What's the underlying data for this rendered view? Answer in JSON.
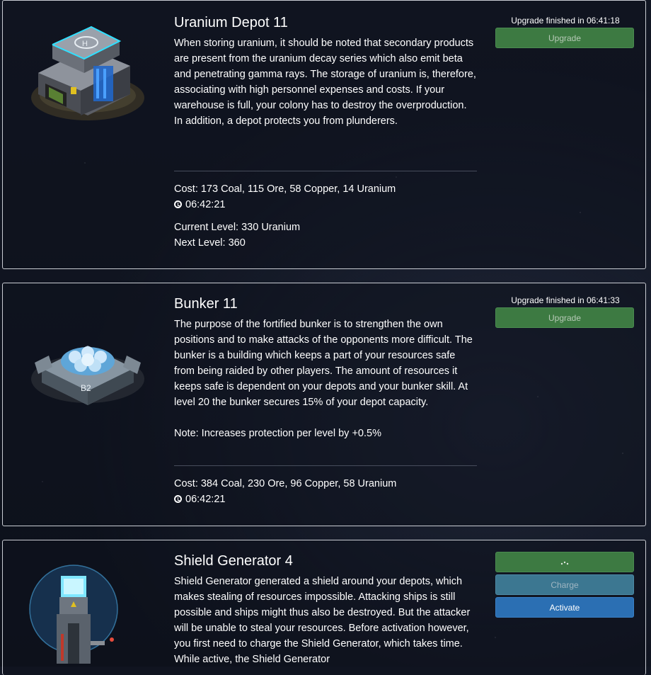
{
  "buildings": [
    {
      "title": "Uranium Depot 11",
      "description": "When storing uranium, it should be noted that secondary products are present from the uranium decay series which also emit beta and penetrating gamma rays. The storage of uranium is, therefore, associating with high personnel expenses and costs. If your warehouse is full, your colony has to destroy the overproduction. In addition, a depot protects you from plunderers.",
      "cost": "Cost: 173 Coal, 115 Ore, 58 Copper, 14 Uranium",
      "time": "06:42:21",
      "current_level": "Current Level: 330 Uranium",
      "next_level": "Next Level: 360",
      "status": "Upgrade finished in 06:41:18",
      "upgrade_label": "Upgrade"
    },
    {
      "title": "Bunker 11",
      "description": "The purpose of the fortified bunker is to strengthen the own positions and to make attacks of the opponents more difficult. The bunker is a building which keeps a part of your resources safe from being raided by other players. The amount of resources it keeps safe is dependent on your depots and your bunker skill. At level 20 the bunker secures 15% of your depot capacity.",
      "note": "Note: Increases protection per level by +0.5%",
      "cost": "Cost: 384 Coal, 230 Ore, 96 Copper, 58 Uranium",
      "time": "06:42:21",
      "status": "Upgrade finished in 06:41:33",
      "upgrade_label": "Upgrade",
      "image_label": "B2"
    },
    {
      "title": "Shield Generator 4",
      "description": "Shield Generator generated a shield around your depots, which makes stealing of resources impossible. Attacking ships is still possible and ships might thus also be destroyed. But the attacker will be unable to steal your resources. Before activation however, you first need to charge the Shield Generator, which takes time. While active, the Shield Generator",
      "charge_label": "Charge",
      "activate_label": "Activate"
    }
  ],
  "colors": {
    "upgrade": "#3d7a42",
    "charge": "#3c7791",
    "activate": "#2b6fb3",
    "border": "#c9ccd3"
  }
}
